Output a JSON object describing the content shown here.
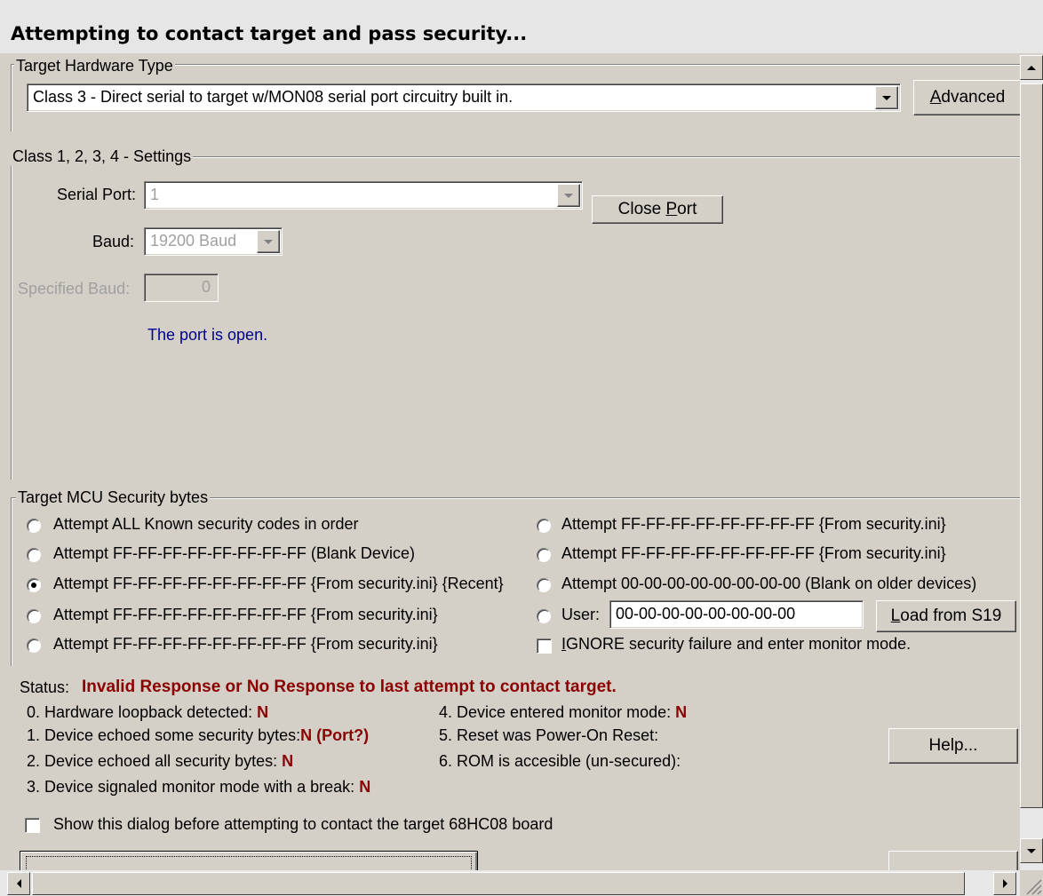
{
  "window": {
    "title": "Attempting to contact target and pass security..."
  },
  "hardware": {
    "group_label": "Target Hardware Type",
    "selected": "Class 3 - Direct serial to target w/MON08 serial port circuitry built in.",
    "advanced_label_u": "A",
    "advanced_label_rest": "dvanced"
  },
  "settings": {
    "group_label": "Class 1, 2, 3, 4 - Settings",
    "serial_port_label": "Serial Port:",
    "serial_port_value": "1",
    "close_port_pre": "Close ",
    "close_port_u": "P",
    "close_port_post": "ort",
    "baud_label": "Baud:",
    "baud_value": "19200 Baud",
    "specified_baud_label": "Specified Baud:",
    "specified_baud_value": "0",
    "port_status": "The port is open."
  },
  "security": {
    "group_label": "Target MCU Security bytes",
    "left_options": [
      {
        "label": "Attempt ALL Known security codes in order",
        "selected": false
      },
      {
        "label": "Attempt FF-FF-FF-FF-FF-FF-FF-FF (Blank Device)",
        "selected": false
      },
      {
        "label": "Attempt FF-FF-FF-FF-FF-FF-FF-FF {From security.ini} {Recent}",
        "selected": true
      },
      {
        "label": "Attempt FF-FF-FF-FF-FF-FF-FF-FF {From security.ini}",
        "selected": false
      },
      {
        "label": "Attempt FF-FF-FF-FF-FF-FF-FF-FF {From security.ini}",
        "selected": false
      }
    ],
    "right_options": [
      {
        "label": "Attempt FF-FF-FF-FF-FF-FF-FF-FF {From security.ini}",
        "selected": false
      },
      {
        "label": "Attempt FF-FF-FF-FF-FF-FF-FF-FF {From security.ini}",
        "selected": false
      },
      {
        "label": "Attempt 00-00-00-00-00-00-00-00 (Blank on older devices)",
        "selected": false
      }
    ],
    "user_label": "User:",
    "user_value": "00-00-00-00-00-00-00-00",
    "load_s19_u": "L",
    "load_s19_rest": "oad from S19",
    "ignore_u": "I",
    "ignore_rest": "GNORE security failure and enter monitor mode.",
    "ignore_checked": false
  },
  "status": {
    "label": "Status:",
    "message": "Invalid Response or No Response to last attempt to contact target.",
    "items_left": [
      {
        "label": "0. Hardware loopback detected:",
        "value": "N"
      },
      {
        "label": "1. Device echoed some security bytes:",
        "value": "N (Port?)"
      },
      {
        "label": "2. Device echoed all security bytes:",
        "value": "N"
      },
      {
        "label": "3. Device signaled monitor mode with a break:",
        "value": "N"
      }
    ],
    "items_right": [
      {
        "label": "4. Device entered monitor mode:",
        "value": "N"
      },
      {
        "label": "5. Reset was Power-On Reset:",
        "value": ""
      },
      {
        "label": "6. ROM is accesible (un-secured):",
        "value": ""
      }
    ],
    "help_label": "Help...",
    "show_dialog_label": "Show this dialog before attempting to contact the target 68HC08 board",
    "show_dialog_checked": false
  },
  "colors": {
    "status_red": "#8b0000",
    "info_blue": "#00008b",
    "face": "#d4d0c8"
  }
}
